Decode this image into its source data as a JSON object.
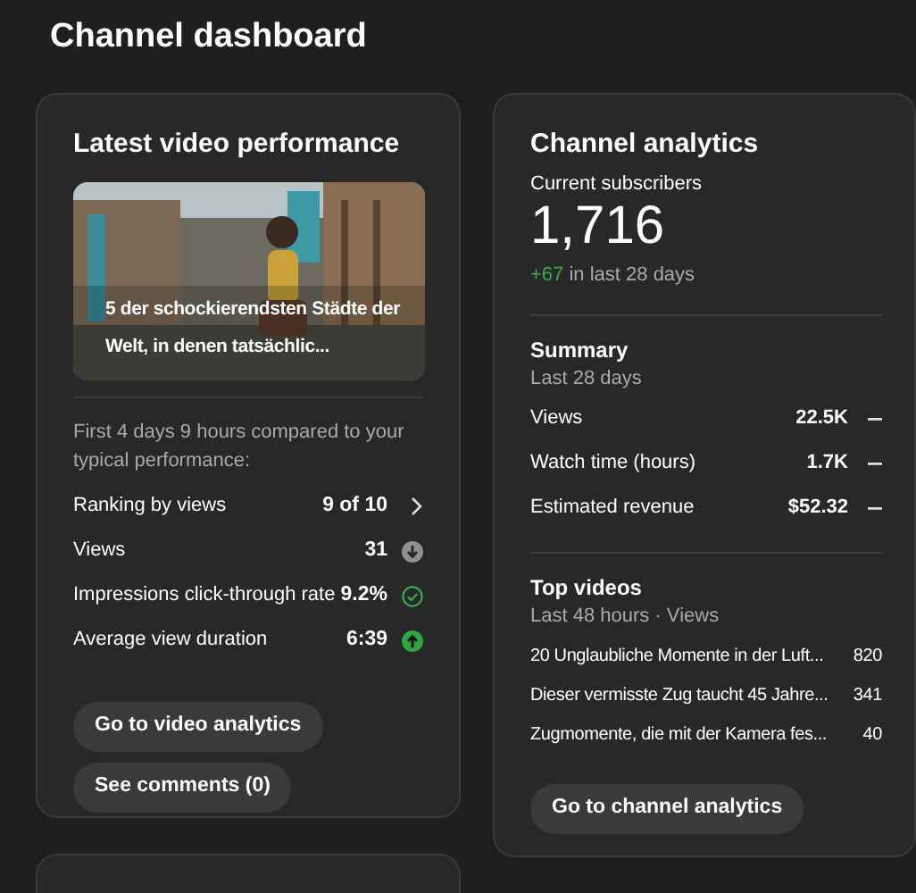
{
  "page_title": "Channel dashboard",
  "latest_video": {
    "title": "Latest video performance",
    "thumbnail": {
      "kind": "picture",
      "caption": "5 der schockierendsten Städte der Welt, in denen tatsächlic..."
    },
    "comparison_note": "First 4 days 9 hours compared to your typical performance:",
    "metrics": [
      {
        "label": "Ranking by views",
        "value": "9 of 10",
        "kind": "link"
      },
      {
        "label": "Views",
        "value": "31",
        "kind": "below"
      },
      {
        "label": "Impressions click-through rate",
        "value": "9.2%",
        "kind": "typical"
      },
      {
        "label": "Average view duration",
        "value": "6:39",
        "kind": "above"
      }
    ],
    "buttons": [
      "Go to video analytics",
      "See comments (0)"
    ]
  },
  "channel_analytics": {
    "title": "Channel analytics",
    "subscribers_label": "Current subscribers",
    "subscribers": "1,716",
    "change": "+67",
    "change_note": "in last 28 days",
    "summary": {
      "title": "Summary",
      "period": "Last 28 days",
      "rows": [
        {
          "label": "Views",
          "value": "22.5K",
          "kind": "neutral"
        },
        {
          "label": "Watch time (hours)",
          "value": "1.7K",
          "kind": "neutral"
        },
        {
          "label": "Estimated revenue",
          "value": "$52.32",
          "kind": "neutral"
        }
      ]
    },
    "top_videos": {
      "title": "Top videos",
      "period": "Last 48 hours · Views",
      "rows": [
        {
          "title": "20 Unglaubliche Momente in der Luft...",
          "views": "820"
        },
        {
          "title": "Dieser vermisste Zug taucht 45 Jahre...",
          "views": "341"
        },
        {
          "title": "Zugmomente, die mit der Kamera fes...",
          "views": "40"
        }
      ]
    },
    "button": "Go to channel analytics"
  }
}
